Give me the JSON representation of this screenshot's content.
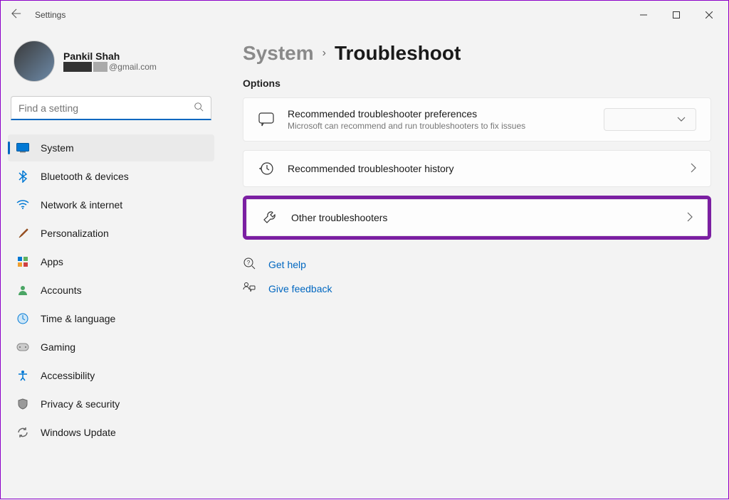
{
  "titlebar": {
    "title": "Settings"
  },
  "profile": {
    "name": "Pankil Shah",
    "email_suffix": "@gmail.com"
  },
  "search": {
    "placeholder": "Find a setting"
  },
  "nav": [
    {
      "icon": "system",
      "label": "System"
    },
    {
      "icon": "bluetooth",
      "label": "Bluetooth & devices"
    },
    {
      "icon": "network",
      "label": "Network & internet"
    },
    {
      "icon": "personalization",
      "label": "Personalization"
    },
    {
      "icon": "apps",
      "label": "Apps"
    },
    {
      "icon": "accounts",
      "label": "Accounts"
    },
    {
      "icon": "time",
      "label": "Time & language"
    },
    {
      "icon": "gaming",
      "label": "Gaming"
    },
    {
      "icon": "accessibility",
      "label": "Accessibility"
    },
    {
      "icon": "privacy",
      "label": "Privacy & security"
    },
    {
      "icon": "update",
      "label": "Windows Update"
    }
  ],
  "breadcrumb": {
    "parent": "System",
    "current": "Troubleshoot"
  },
  "section": "Options",
  "cards": {
    "prefs": {
      "title": "Recommended troubleshooter preferences",
      "subtitle": "Microsoft can recommend and run troubleshooters to fix issues"
    },
    "history": {
      "title": "Recommended troubleshooter history"
    },
    "other": {
      "title": "Other troubleshooters"
    }
  },
  "links": {
    "help": "Get help",
    "feedback": "Give feedback"
  }
}
